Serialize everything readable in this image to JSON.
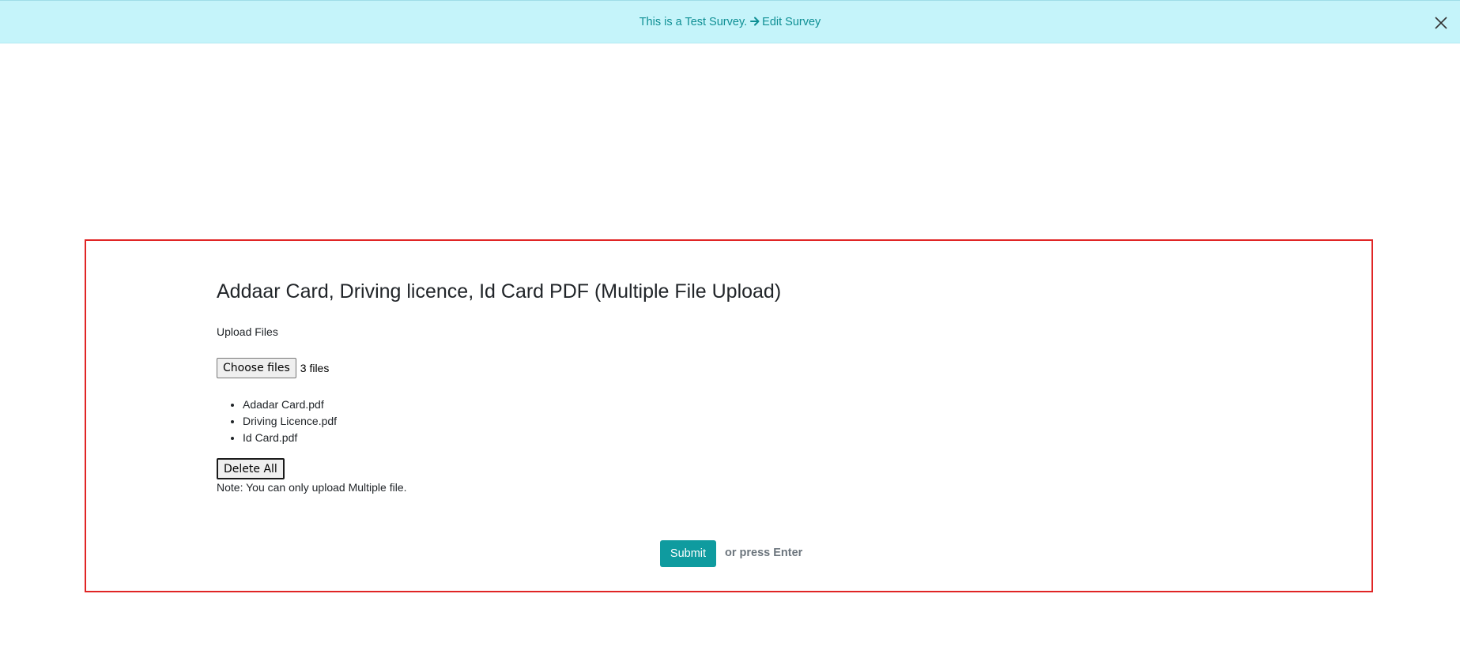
{
  "banner": {
    "message": "This is a Test Survey.",
    "edit_link_label": "Edit Survey",
    "arrow_icon": "arrow-right-icon",
    "close_icon": "close-icon",
    "background_color": "#c5f4fa",
    "text_color": "#0e8f94"
  },
  "question": {
    "title": "Addaar Card, Driving licence, Id Card PDF (Multiple File Upload)",
    "upload_label": "Upload Files",
    "choose_files_label": "Choose files",
    "file_count_text": "3 files",
    "files": [
      "Adadar Card.pdf",
      "Driving Licence.pdf",
      "Id Card.pdf"
    ],
    "delete_all_label": "Delete All",
    "note": "Note: You can only upload Multiple file."
  },
  "footer": {
    "submit_label": "Submit",
    "press_enter_hint": "or press Enter",
    "accent_color": "#0f9b9f"
  },
  "frame_border_color": "#e02525"
}
